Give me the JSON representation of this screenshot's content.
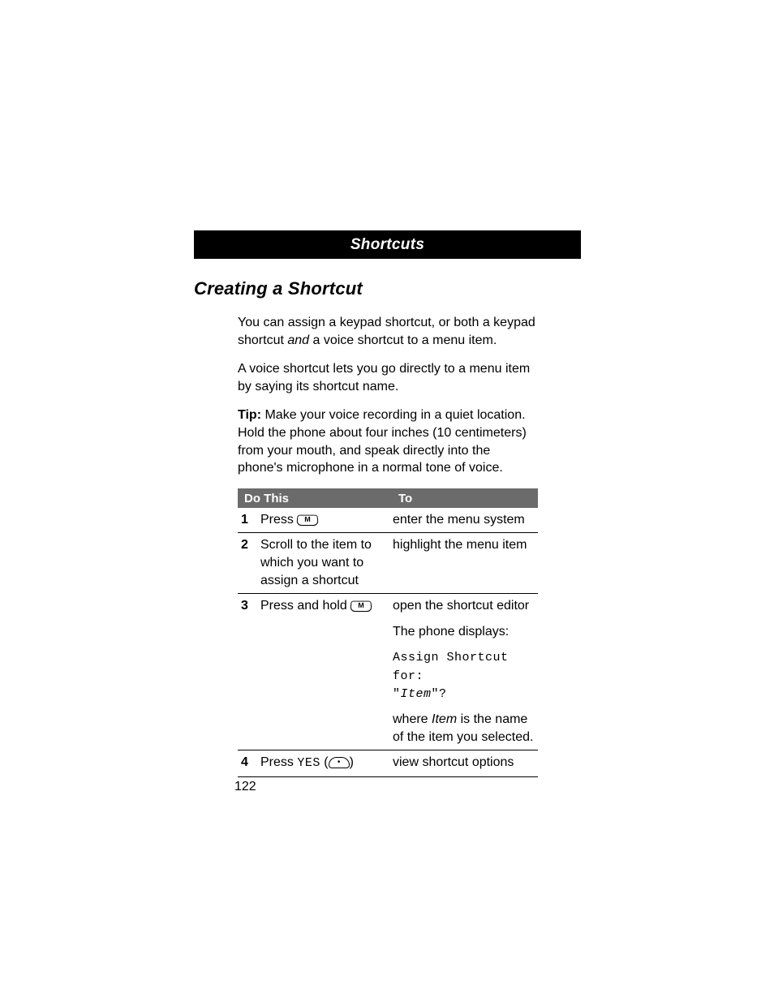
{
  "header": {
    "title": "Shortcuts"
  },
  "section": {
    "heading": "Creating a Shortcut"
  },
  "paragraphs": {
    "p1_a": "You can assign a keypad shortcut, or both a keypad shortcut ",
    "p1_b": "and",
    "p1_c": " a voice shortcut to a menu item.",
    "p2": "A voice shortcut lets you go directly to a menu item by saying its shortcut name.",
    "p3_tip": "Tip:",
    "p3_rest": " Make your voice recording in a quiet location. Hold the phone about four inches (10 centimeters) from your mouth, and speak directly into the phone's microphone in a normal tone of voice."
  },
  "table": {
    "headers": {
      "left": "Do This",
      "right": "To"
    },
    "rows": [
      {
        "num": "1",
        "do_pre": "Press ",
        "key": "M",
        "to": "enter the menu system"
      },
      {
        "num": "2",
        "do": "Scroll to the item to which you want to assign a shortcut",
        "to": "highlight the menu item"
      },
      {
        "num": "3",
        "do_pre": "Press and hold ",
        "key": "M",
        "to_line1": "open the shortcut editor",
        "to_line2": "The phone displays:",
        "to_mono_a": "Assign Shortcut for:",
        "to_mono_b_open": "\"",
        "to_mono_b_item": "Item",
        "to_mono_b_close": "\"?",
        "to_line4_a": "where ",
        "to_line4_b": "Item",
        "to_line4_c": " is the name of the item you selected."
      },
      {
        "num": "4",
        "do_pre": "Press ",
        "do_yes": "YES",
        "do_open": " (",
        "do_close": ")",
        "to": "view shortcut options"
      }
    ]
  },
  "pageNumber": "122"
}
